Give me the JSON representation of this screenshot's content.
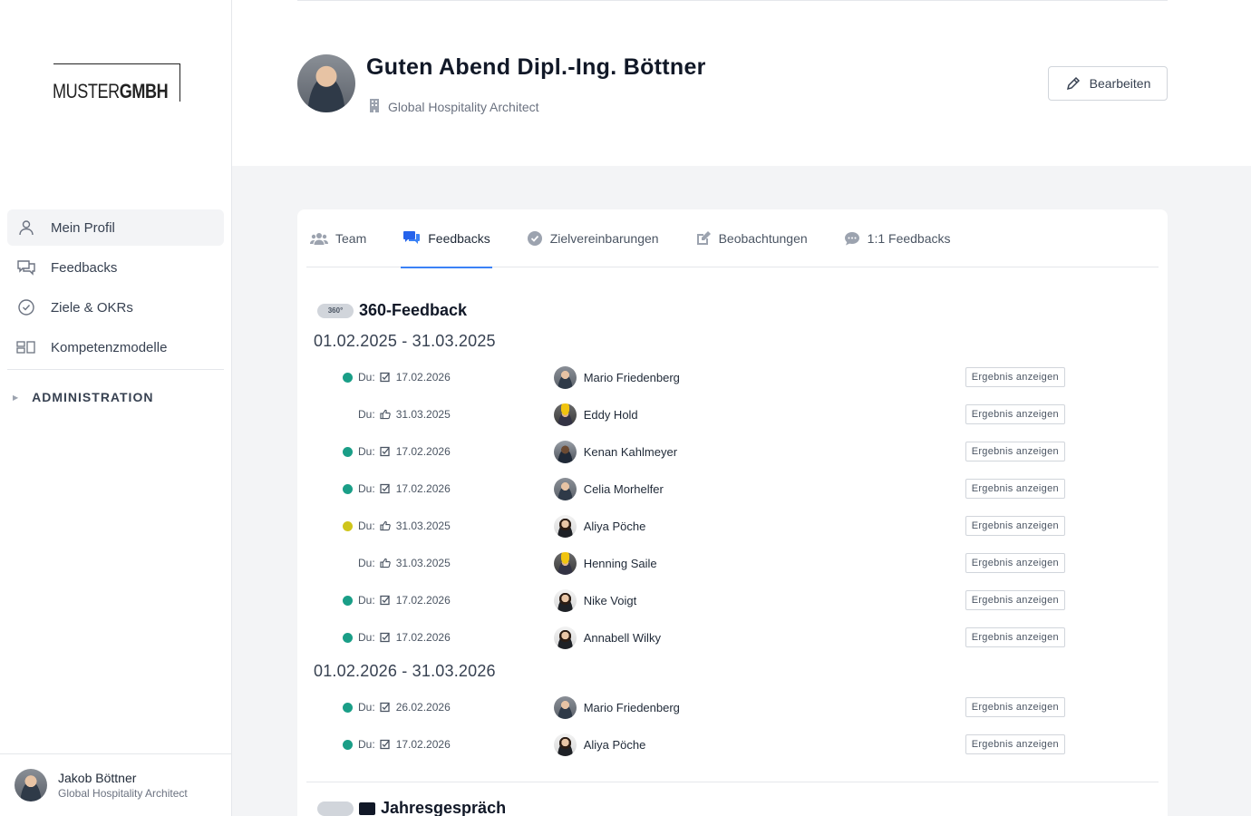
{
  "logo": {
    "muster": "MUSTER",
    "gmbh": "GMBH"
  },
  "sidebar": {
    "items": [
      {
        "label": "Mein Profil",
        "icon": "user-icon",
        "active": true
      },
      {
        "label": "Feedbacks",
        "icon": "chat-icon",
        "active": false
      },
      {
        "label": "Ziele & OKRs",
        "icon": "check-circle-icon",
        "active": false
      },
      {
        "label": "Kompetenzmodelle",
        "icon": "blocks-icon",
        "active": false
      }
    ],
    "admin_label": "ADMINISTRATION"
  },
  "footer_user": {
    "name": "Jakob Böttner",
    "role": "Global Hospitality Architect"
  },
  "header": {
    "greeting": "Guten Abend Dipl.-Ing. Böttner",
    "role": "Global Hospitality Architect",
    "edit_label": "Bearbeiten"
  },
  "tabs": [
    {
      "label": "Team",
      "icon": "users-icon",
      "active": false
    },
    {
      "label": "Feedbacks",
      "icon": "chat-bubbles-icon",
      "active": true
    },
    {
      "label": "Zielvereinbarungen",
      "icon": "check-circle-icon",
      "active": false
    },
    {
      "label": "Beobachtungen",
      "icon": "edit-icon",
      "active": false
    },
    {
      "label": "1:1 Feedbacks",
      "icon": "comment-icon",
      "active": false
    }
  ],
  "feedback360": {
    "badge": "360°",
    "title": "360-Feedback",
    "result_label": "Ergebnis anzeigen",
    "du_label": "Du:",
    "periods": [
      {
        "range": "01.02.2025 - 31.03.2025",
        "rows": [
          {
            "status": "green",
            "type": "check",
            "date": "17.02.2026",
            "person": "Mario Friedenberg",
            "avatar": "m"
          },
          {
            "status": "none",
            "type": "thumb",
            "date": "31.03.2025",
            "person": "Eddy Hold",
            "avatar": "h"
          },
          {
            "status": "green",
            "type": "check",
            "date": "17.02.2026",
            "person": "Kenan Kahlmeyer",
            "avatar": "d"
          },
          {
            "status": "green",
            "type": "check",
            "date": "17.02.2026",
            "person": "Celia Morhelfer",
            "avatar": "m"
          },
          {
            "status": "yellow",
            "type": "thumb",
            "date": "31.03.2025",
            "person": "Aliya Pöche",
            "avatar": "f"
          },
          {
            "status": "none",
            "type": "thumb",
            "date": "31.03.2025",
            "person": "Henning Saile",
            "avatar": "h"
          },
          {
            "status": "green",
            "type": "check",
            "date": "17.02.2026",
            "person": "Nike Voigt",
            "avatar": "f"
          },
          {
            "status": "green",
            "type": "check",
            "date": "17.02.2026",
            "person": "Annabell Wilky",
            "avatar": "f"
          }
        ]
      },
      {
        "range": "01.02.2026 - 31.03.2026",
        "rows": [
          {
            "status": "green",
            "type": "check",
            "date": "26.02.2026",
            "person": "Mario Friedenberg",
            "avatar": "m"
          },
          {
            "status": "green",
            "type": "check",
            "date": "17.02.2026",
            "person": "Aliya Pöche",
            "avatar": "f"
          }
        ]
      }
    ]
  },
  "jahresgespraech": {
    "title": "Jahresgespräch"
  },
  "colors": {
    "green": "#1a9e87",
    "yellow": "#cfc51b",
    "accent": "#3b82f6"
  }
}
